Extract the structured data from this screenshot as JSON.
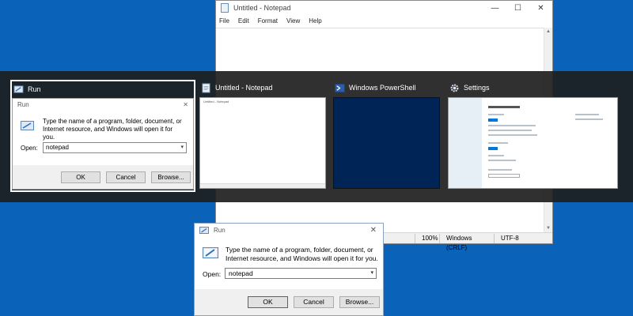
{
  "notepad_window": {
    "title": "Untitled - Notepad",
    "menu": [
      "File",
      "Edit",
      "Format",
      "View",
      "Help"
    ],
    "controls": {
      "minimize": "—",
      "maximize": "☐",
      "close": "✕"
    },
    "status": {
      "zoom": "100%",
      "line_ending": "Windows (CRLF)",
      "encoding": "UTF-8"
    }
  },
  "switcher": {
    "items": [
      {
        "label": "Run",
        "icon": "run-icon",
        "selected": true
      },
      {
        "label": "Untitled - Notepad",
        "icon": "notepad-icon",
        "selected": false
      },
      {
        "label": "Windows PowerShell",
        "icon": "powershell-icon",
        "selected": false
      },
      {
        "label": "Settings",
        "icon": "gear-icon",
        "selected": false
      }
    ],
    "preview_run": {
      "title": "Run",
      "message": "Type the name of a program, folder, document, or Internet resource, and Windows will open it for you.",
      "open_label": "Open:",
      "open_value": "notepad",
      "ok": "OK",
      "cancel": "Cancel",
      "browse": "Browse..."
    },
    "preview_notepad_title": "Untitled - Notepad"
  },
  "run_dialog": {
    "title": "Run",
    "message": "Type the name of a program, folder, document, or Internet resource, and Windows will open it for you.",
    "open_label": "Open:",
    "open_value": "notepad",
    "ok": "OK",
    "cancel": "Cancel",
    "browse": "Browse...",
    "close": "✕"
  },
  "colors": {
    "desktop": "#0a63b8",
    "powershell_bg": "#012456",
    "accent": "#0078d7"
  }
}
